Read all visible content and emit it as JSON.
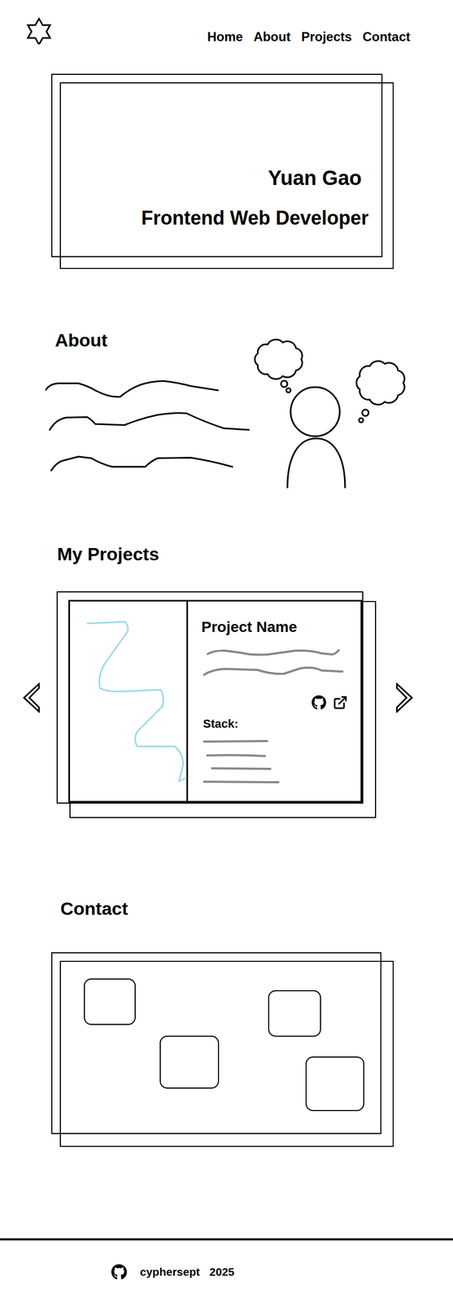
{
  "nav": [
    "Home",
    "About",
    "Projects",
    "Contact"
  ],
  "hero": {
    "name": "Yuan Gao",
    "title": "Frontend Web Developer"
  },
  "about": {
    "heading": "About"
  },
  "projects": {
    "heading": "My Projects",
    "card": {
      "name": "Project Name",
      "stack_label": "Stack:"
    }
  },
  "contact": {
    "heading": "Contact"
  },
  "footer": {
    "handle": "cyphersept",
    "year": "2025"
  }
}
